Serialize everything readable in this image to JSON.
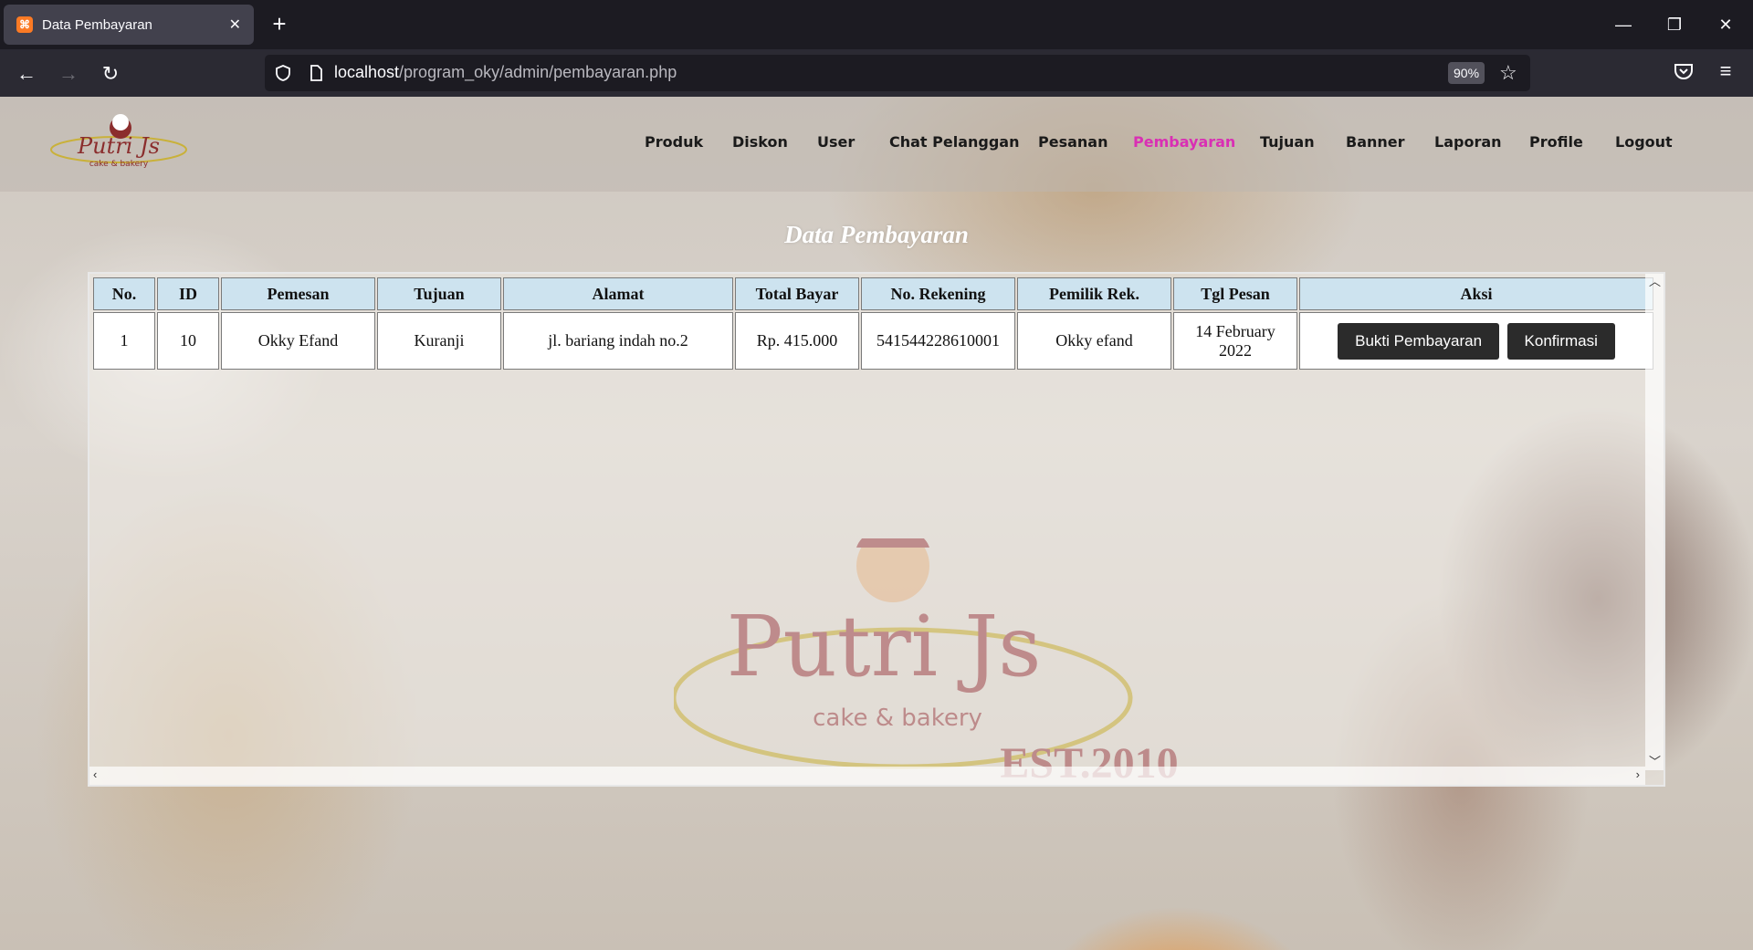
{
  "browser": {
    "tab_title": "Data Pembayaran",
    "url_host": "localhost",
    "url_path": "/program_oky/admin/pembayaran.php",
    "zoom": "90%"
  },
  "site": {
    "logo_text": "Putri Js",
    "logo_subtext": "cake & bakery",
    "menu": [
      {
        "label": "Produk"
      },
      {
        "label": "Diskon"
      },
      {
        "label": "User"
      },
      {
        "label": "Chat Pelanggan"
      },
      {
        "label": "Pesanan"
      },
      {
        "label": "Pembayaran",
        "active": true
      },
      {
        "label": "Tujuan"
      },
      {
        "label": "Banner"
      },
      {
        "label": "Laporan"
      },
      {
        "label": "Profile"
      },
      {
        "label": "Logout"
      }
    ],
    "active_color": "#d92fb4"
  },
  "main": {
    "heading": "Data Pembayaran",
    "table": {
      "headers": [
        "No.",
        "ID",
        "Pemesan",
        "Tujuan",
        "Alamat",
        "Total Bayar",
        "No. Rekening",
        "Pemilik Rek.",
        "Tgl Pesan",
        "Aksi"
      ],
      "rows": [
        {
          "no": "1",
          "id": "10",
          "pemesan": "Okky Efand",
          "tujuan": "Kuranji",
          "alamat": "jl. bariang indah no.2",
          "total": "Rp. 415.000",
          "rekening": "541544228610001",
          "pemilik": "Okky efand",
          "tgl": "14 February 2022",
          "btn_bukti": "Bukti Pembayaran",
          "btn_konfirmasi": "Konfirmasi"
        }
      ]
    }
  },
  "watermark": {
    "brand": "Putri Js",
    "tagline": "cake & bakery",
    "est": "EST.2010"
  }
}
